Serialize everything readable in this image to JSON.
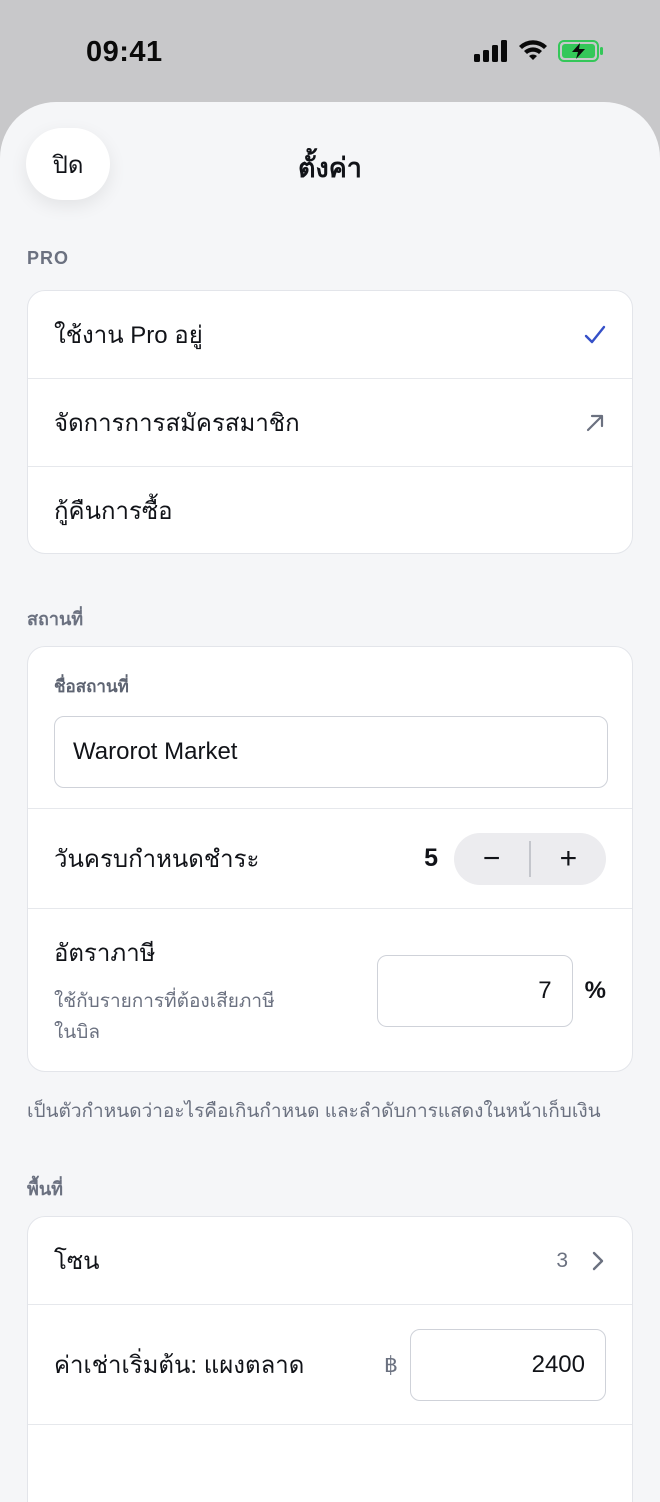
{
  "status": {
    "time": "09:41"
  },
  "header": {
    "close_label": "ปิด",
    "title": "ตั้งค่า"
  },
  "pro": {
    "section_label": "PRO",
    "items": [
      {
        "label": "ใช้งาน Pro อยู่",
        "accessory": "checkmark-icon"
      },
      {
        "label": "จัดการการสมัครสมาชิก",
        "accessory": "arrow-up-right-icon"
      },
      {
        "label": "กู้คืนการซื้อ",
        "accessory": ""
      }
    ]
  },
  "location": {
    "section_label": "สถานที่",
    "name_label": "ชื่อสถานที่",
    "name_value": "Warorot Market",
    "due_label": "วันครบกำหนดชำระ",
    "due_value": "5",
    "minus": "−",
    "plus": "+",
    "tax_label": "อัตราภาษี",
    "tax_sub_line1": "ใช้กับรายการที่ต้องเสียภาษี",
    "tax_sub_line2": "ในบิล",
    "tax_value": "7",
    "tax_unit": "%",
    "helper": "เป็นตัวกำหนดว่าอะไรคือเกินกำหนด และลำดับการแสดงในหน้าเก็บเงิน"
  },
  "area": {
    "section_label": "พื้นที่",
    "zones_label": "โซน",
    "zones_count": "3",
    "rent_label": "ค่าเช่าเริ่มต้น: แผงตลาด",
    "currency": "฿",
    "rent_value": "2400"
  },
  "colors": {
    "accent": "#3550c8",
    "background": "#f5f6f8",
    "battery": "#34c759"
  }
}
